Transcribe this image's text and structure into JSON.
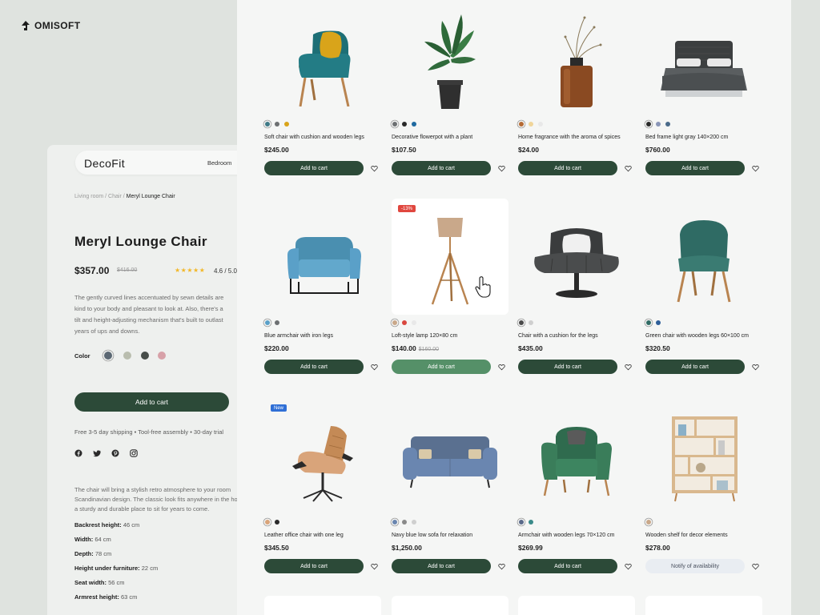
{
  "brand": {
    "name": "OMISOFT",
    "icon": "omisoft-logo-icon"
  },
  "detail": {
    "logo": "DecoFit",
    "nav": [
      "Bedroom"
    ],
    "breadcrumb": [
      "Living room",
      "Chair",
      "Meryl Lounge Chair"
    ],
    "breadcrumb_sep": "/",
    "title": "Meryl Lounge Chair",
    "price": "$357.00",
    "old_price": "$416.00",
    "stars": "★★★★★",
    "rating": "4.6 / 5.0",
    "description": [
      "The gently curved lines accentuated by sewn details are",
      "kind to your body and pleasant to look at. Also, there's a",
      "tilt and height-adjusting mechanism that's built to outlast",
      "years of ups and downs."
    ],
    "color_label": "Color",
    "colors": [
      "#5b6873",
      "#b9bdae",
      "#474d49",
      "#d7a1a8"
    ],
    "add_to_cart": "Add to cart",
    "shipping": "Free 3-5 day shipping  •  Tool-free assembly  •  30-day trial",
    "social_icons": [
      "facebook-icon",
      "twitter-icon",
      "pinterest-icon",
      "instagram-icon"
    ],
    "about": [
      "The chair will bring a stylish retro atmosphere to your room",
      "Scandinavian design. The classic look fits anywhere in the home",
      "a sturdy and durable place to sit for years to come."
    ],
    "specs": [
      {
        "label": "Backrest height:",
        "value": "46 cm"
      },
      {
        "label": "Width:",
        "value": "64 cm"
      },
      {
        "label": "Depth:",
        "value": "78 cm"
      },
      {
        "label": "Height under furniture:",
        "value": "22 cm"
      },
      {
        "label": "Seat width:",
        "value": "56 cm"
      },
      {
        "label": "Armrest height:",
        "value": "63 cm"
      }
    ]
  },
  "catalog": {
    "products": [
      {
        "name": "Soft chair with cushion and wooden legs",
        "price": "$245.00",
        "button": "Add to cart",
        "colors": [
          "#3f7a87",
          "#6d7072",
          "#d9a41a"
        ],
        "image": "teal-armchair"
      },
      {
        "name": "Decorative flowerpot with a plant",
        "price": "$107.50",
        "button": "Add to cart",
        "colors": [
          "#6d7072",
          "#2a2a2a",
          "#1f6aa0"
        ],
        "image": "potted-plant"
      },
      {
        "name": "Home fragrance with the aroma of spices",
        "price": "$24.00",
        "button": "Add to cart",
        "colors": [
          "#b56b35",
          "#f0d59a",
          "#e8e8e8"
        ],
        "image": "fragrance-vase"
      },
      {
        "name": "Bed frame light gray 140×200 cm",
        "price": "$760.00",
        "button": "Add to cart",
        "colors": [
          "#2a2a2a",
          "#8a96b8",
          "#4a6a8a"
        ],
        "image": "gray-bed"
      },
      {
        "name": "Blue armchair with iron legs",
        "price": "$220.00",
        "button": "Add to cart",
        "colors": [
          "#5aa0c8",
          "#6d7072"
        ],
        "image": "blue-armchair"
      },
      {
        "name": "Loft-style lamp 120×80 cm",
        "price": "$140.00",
        "old_price": "$160.00",
        "badge": "-13%",
        "button": "Add to cart",
        "colors": [
          "#c9a88a",
          "#d9473f",
          "#e8e8e8"
        ],
        "image": "tripod-lamp"
      },
      {
        "name": "Chair with a cushion for the legs",
        "price": "$435.00",
        "button": "Add to cart",
        "colors": [
          "#4a4a4a",
          "#cfcfcf"
        ],
        "image": "swivel-chair"
      },
      {
        "name": "Green chair with wooden legs 60×100 cm",
        "price": "$320.50",
        "button": "Add to cart",
        "colors": [
          "#2f6b64",
          "#2f5f9a"
        ],
        "image": "green-chair"
      },
      {
        "name": "Leather office chair with one leg",
        "price": "$345.50",
        "badge": "New",
        "button": "Add to cart",
        "colors": [
          "#d9a47a",
          "#2a2a2a"
        ],
        "image": "leather-lounge-chair"
      },
      {
        "name": "Navy blue low sofa for relaxation",
        "price": "$1,250.00",
        "button": "Add to cart",
        "colors": [
          "#6a86b0",
          "#8a8a8a",
          "#cfcfcf"
        ],
        "image": "blue-sofa"
      },
      {
        "name": "Armchair with wooden legs 70×120 cm",
        "price": "$269.99",
        "button": "Add to cart",
        "colors": [
          "#5a6a8a",
          "#3a8a8a"
        ],
        "image": "green-armchair"
      },
      {
        "name": "Wooden shelf for decor elements",
        "price": "$278.00",
        "button": "Notify of availability",
        "colors": [
          "#c9a88a"
        ],
        "image": "wooden-shelf"
      }
    ]
  }
}
